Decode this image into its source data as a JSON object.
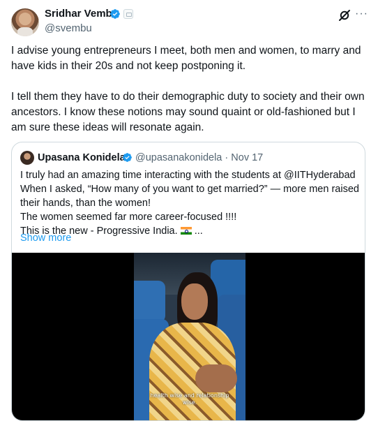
{
  "author": {
    "name": "Sridhar Vembu",
    "handle": "@svembu"
  },
  "tweet_paragraphs": [
    "I advise young entrepreneurs I meet, both men and women, to marry and have kids in their 20s and not keep postponing it.",
    "I tell them they have to do their demographic duty to society and their own ancestors. I know these notions may sound quaint or old-fashioned but I am sure these ideas will resonate again."
  ],
  "quoted": {
    "name": "Upasana Konidela",
    "handle": "@upasanakonidela",
    "separator": "·",
    "date": "Nov 17",
    "lines": [
      "I truly had an amazing time interacting with the students at @IITHyderabad",
      "When I asked, “How many of you want to get married?” — more men raised",
      "their hands, than the women!",
      "The women seemed far more career-focused !!!!",
      "This is the new - Progressive India."
    ],
    "ellipsis": "...",
    "show_more": "Show more",
    "video_caption_1": "health wise and relationship",
    "video_caption_2": "wise."
  },
  "icons": {
    "verified": "verified-badge-icon",
    "affiliate": "affiliate-badge-icon",
    "grok": "grok-icon",
    "more": "more-options-icon",
    "flag": "india-flag-icon"
  },
  "colors": {
    "accent": "#1d9bf0",
    "secondary_text": "#536471",
    "border": "#cfd9de"
  }
}
